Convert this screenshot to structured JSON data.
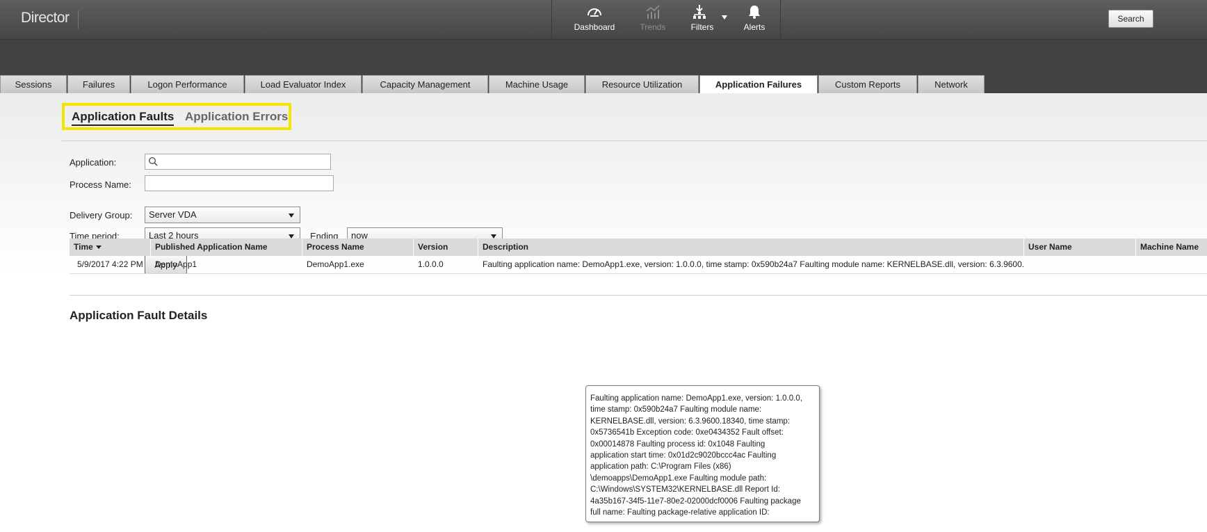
{
  "app": {
    "title": "Director"
  },
  "nav": {
    "items": [
      {
        "label": "Dashboard",
        "icon": "dashboard-gauge-icon",
        "enabled": true
      },
      {
        "label": "Trends",
        "icon": "trends-chart-icon",
        "enabled": false
      },
      {
        "label": "Filters",
        "icon": "filters-funnel-icon",
        "enabled": true
      },
      {
        "label": "Alerts",
        "icon": "bell-icon",
        "enabled": true
      }
    ]
  },
  "header": {
    "search_label": "Search"
  },
  "tabs": [
    {
      "label": "Sessions",
      "active": false
    },
    {
      "label": "Failures",
      "active": false
    },
    {
      "label": "Logon Performance",
      "active": false
    },
    {
      "label": "Load Evaluator Index",
      "active": false
    },
    {
      "label": "Capacity Management",
      "active": false
    },
    {
      "label": "Machine Usage",
      "active": false
    },
    {
      "label": "Resource Utilization",
      "active": false
    },
    {
      "label": "Application Failures",
      "active": true
    },
    {
      "label": "Custom Reports",
      "active": false
    },
    {
      "label": "Network",
      "active": false
    }
  ],
  "subtabs": [
    {
      "label": "Application Faults",
      "active": true
    },
    {
      "label": "Application Errors",
      "active": false
    }
  ],
  "colors": {
    "highlight": "#f2e500",
    "topbar": "#555555",
    "band": "#424242"
  },
  "filters": {
    "application": {
      "label": "Application:",
      "value": "",
      "placeholder": ""
    },
    "process_name": {
      "label": "Process Name:",
      "value": ""
    },
    "delivery_group": {
      "label": "Delivery Group:",
      "value": "Server VDA"
    },
    "time_period": {
      "label": "Time period:",
      "value": "Last 2 hours"
    },
    "ending": {
      "label": "Ending",
      "value": "now"
    },
    "apply_label": "Apply"
  },
  "details": {
    "title": "Application Fault Details",
    "columns": [
      "Time",
      "Published Application Name",
      "Process Name",
      "Version",
      "Description",
      "User Name",
      "Machine Name"
    ],
    "rows": [
      {
        "time": "5/9/2017 4:22 PM",
        "app_name": "DemoApp1",
        "process": "DemoApp1.exe",
        "version": "1.0.0.0",
        "description": "Faulting application name: DemoApp1.exe, version: 1.0.0.0, time stamp: 0x590b24a7 Faulting module name: KERNELBASE.dll, version: 6.3.9600.18340, time stamp: 0x5736541b",
        "user": "",
        "machine": ""
      }
    ]
  },
  "tooltip": {
    "lines": [
      "Faulting application name: DemoApp1.exe, version: 1.0.0.0,",
      "time stamp: 0x590b24a7 Faulting module name:",
      "KERNELBASE.dll, version: 6.3.9600.18340, time stamp:",
      "0x5736541b Exception code: 0xe0434352 Fault offset:",
      "0x00014878 Faulting process id: 0x1048 Faulting",
      "application start time: 0x01d2c9020bccc4ac Faulting",
      "application path: C:\\Program Files (x86)",
      "\\demoapps\\DemoApp1.exe Faulting module path:",
      "C:\\Windows\\SYSTEM32\\KERNELBASE.dll Report Id:",
      "4a35b167-34f5-11e7-80e2-02000dcf0006 Faulting package",
      "full name: Faulting package-relative application ID:"
    ]
  }
}
